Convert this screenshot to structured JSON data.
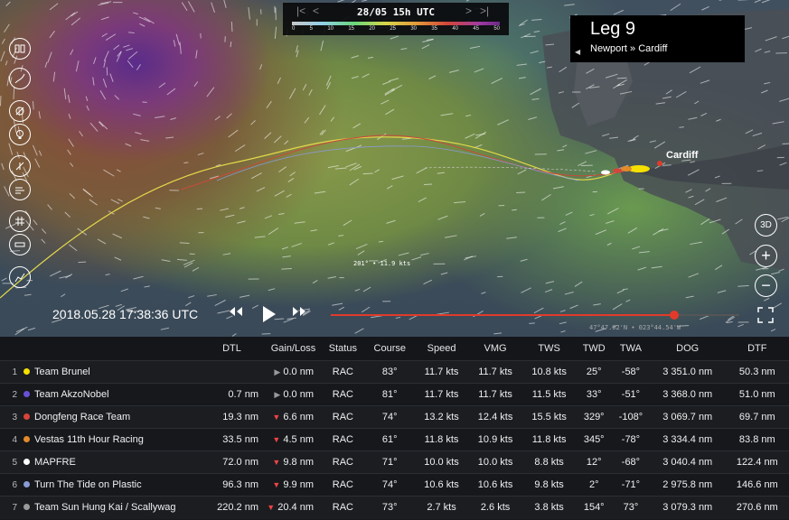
{
  "time_bar": {
    "label": "28/05 15h UTC",
    "scale_ticks": [
      "0",
      "5",
      "10",
      "15",
      "20",
      "25",
      "30",
      "35",
      "40",
      "45",
      "50"
    ]
  },
  "leg": {
    "title": "Leg 9",
    "route": "Newport » Cardiff"
  },
  "map": {
    "city_label": "Cardiff",
    "wind_readout": "201° • 11.9 kts",
    "coordinates": "47°47.02'N • 023°44.54'W",
    "zoom_3d_label": "3D"
  },
  "playback": {
    "datetime": "2018.05.28 17:38:36 UTC",
    "progress": 0.84
  },
  "tools": {
    "left": [
      "book-icon",
      "route-icon",
      "layers-icon",
      "bulb-icon",
      "compass-icon",
      "wind-icon",
      "grid-icon",
      "ruler-icon",
      "graph-icon"
    ]
  },
  "table": {
    "headers": [
      "DTL",
      "Gain/Loss",
      "Status",
      "Course",
      "Speed",
      "VMG",
      "TWS",
      "TWD",
      "TWA",
      "DOG",
      "DTF"
    ],
    "rows": [
      {
        "rank": "1",
        "color": "#f5e000",
        "name": "Team Brunel",
        "dtl": "",
        "gain": "0.0 nm",
        "gain_dir": "side",
        "status": "RAC",
        "course": "83°",
        "speed": "11.7 kts",
        "vmg": "11.7 kts",
        "tws": "10.8 kts",
        "twd": "25°",
        "twa": "-58°",
        "dog": "3 351.0 nm",
        "dtf": "50.3 nm"
      },
      {
        "rank": "2",
        "color": "#6a4fd6",
        "name": "Team AkzoNobel",
        "dtl": "0.7 nm",
        "gain": "0.0 nm",
        "gain_dir": "side",
        "status": "RAC",
        "course": "81°",
        "speed": "11.7 kts",
        "vmg": "11.7 kts",
        "tws": "11.5 kts",
        "twd": "33°",
        "twa": "-51°",
        "dog": "3 368.0 nm",
        "dtf": "51.0 nm"
      },
      {
        "rank": "3",
        "color": "#d6443a",
        "name": "Dongfeng Race Team",
        "dtl": "19.3 nm",
        "gain": "6.6 nm",
        "gain_dir": "up",
        "status": "RAC",
        "course": "74°",
        "speed": "13.2 kts",
        "vmg": "12.4 kts",
        "tws": "15.5 kts",
        "twd": "329°",
        "twa": "-108°",
        "dog": "3 069.7 nm",
        "dtf": "69.7 nm"
      },
      {
        "rank": "4",
        "color": "#e38a2a",
        "name": "Vestas 11th Hour Racing",
        "dtl": "33.5 nm",
        "gain": "4.5 nm",
        "gain_dir": "up",
        "status": "RAC",
        "course": "61°",
        "speed": "11.8 kts",
        "vmg": "10.9 kts",
        "tws": "11.8 kts",
        "twd": "345°",
        "twa": "-78°",
        "dog": "3 334.4 nm",
        "dtf": "83.8 nm"
      },
      {
        "rank": "5",
        "color": "#ffffff",
        "name": "MAPFRE",
        "dtl": "72.0 nm",
        "gain": "9.8 nm",
        "gain_dir": "up",
        "status": "RAC",
        "course": "71°",
        "speed": "10.0 kts",
        "vmg": "10.0 kts",
        "tws": "8.8 kts",
        "twd": "12°",
        "twa": "-68°",
        "dog": "3 040.4 nm",
        "dtf": "122.4 nm"
      },
      {
        "rank": "6",
        "color": "#8a9ad6",
        "name": "Turn The Tide on Plastic",
        "dtl": "96.3 nm",
        "gain": "9.9 nm",
        "gain_dir": "up",
        "status": "RAC",
        "course": "74°",
        "speed": "10.6 kts",
        "vmg": "10.6 kts",
        "tws": "9.8 kts",
        "twd": "2°",
        "twa": "-71°",
        "dog": "2 975.8 nm",
        "dtf": "146.6 nm"
      },
      {
        "rank": "7",
        "color": "#9a9a9a",
        "name": "Team Sun Hung Kai / Scallywag",
        "dtl": "220.2 nm",
        "gain": "20.4 nm",
        "gain_dir": "up",
        "status": "RAC",
        "course": "73°",
        "speed": "2.7 kts",
        "vmg": "2.6 kts",
        "tws": "3.8 kts",
        "twd": "154°",
        "twa": "73°",
        "dog": "3 079.3 nm",
        "dtf": "270.6 nm"
      }
    ]
  }
}
